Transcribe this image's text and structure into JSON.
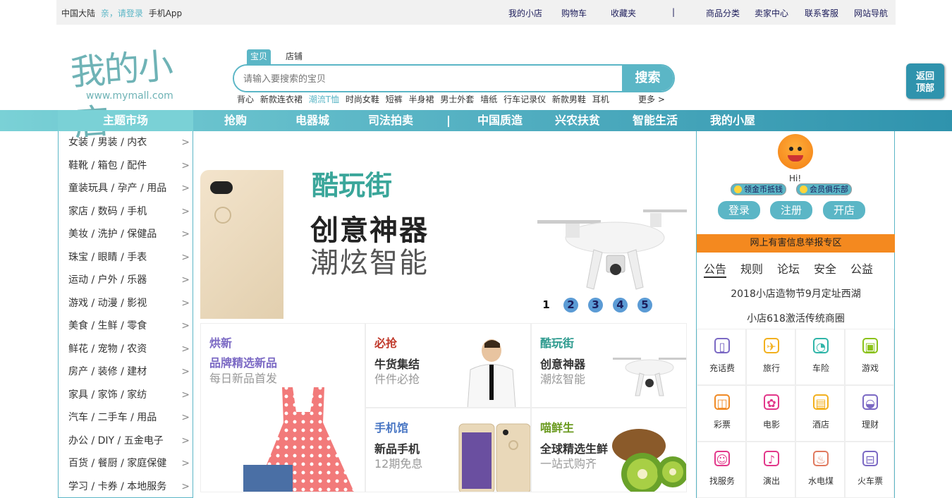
{
  "topbar": {
    "region": "中国大陆",
    "login": "亲，请登录",
    "app": "手机App",
    "links": [
      "我的小店",
      "购物车",
      "收藏夹",
      "|",
      "商品分类",
      "卖家中心",
      "联系客服",
      "网站导航"
    ]
  },
  "logo": {
    "cn": "我的小店",
    "en": "www.mymall.com"
  },
  "search": {
    "tabs": [
      "宝贝",
      "店铺"
    ],
    "placeholder": "请输入要搜索的宝贝",
    "button": "搜索",
    "hot": [
      "背心",
      "新款连衣裙",
      "潮流T恤",
      "时尚女鞋",
      "短裤",
      "半身裙",
      "男士外套",
      "墙纸",
      "行车记录仪",
      "新款男鞋",
      "耳机"
    ],
    "more": "更多 >"
  },
  "back_top": {
    "line1": "返回",
    "line2": "顶部"
  },
  "nav": {
    "category_title": "主题市场",
    "items": [
      "抢购",
      "电器城",
      "司法拍卖",
      "|",
      "中国质造",
      "兴农扶贫",
      "智能生活",
      "我的小屋"
    ]
  },
  "categories": [
    "女装 / 男装 / 内衣",
    "鞋靴 / 箱包 / 配件",
    "童装玩具 / 孕产 / 用品",
    "家店 / 数码 / 手机",
    "美妆 / 洗护 / 保健品",
    "珠宝 / 眼睛 / 手表",
    "运动 / 户外 / 乐器",
    "游戏 / 动漫 / 影视",
    "美食 / 生鲜 / 零食",
    "鲜花 / 宠物 / 农资",
    "房产 / 装修 / 建材",
    "家具 / 家饰 / 家纺",
    "汽车 / 二手车 / 用品",
    "办公 / DIY / 五金电子",
    "百货 / 餐厨 / 家庭保健",
    "学习 / 卡券 / 本地服务"
  ],
  "category_arrow": ">",
  "banner": {
    "title": "酷玩街",
    "line1": "创意神器",
    "line2": "潮炫智能",
    "dots": [
      "1",
      "2",
      "3",
      "4",
      "5"
    ],
    "active_dot": 0
  },
  "promos": [
    {
      "tag": "烘新",
      "title": "品牌精选新品",
      "sub": "每日新品首发",
      "tag_color": "#7b69c4"
    },
    {
      "tag": "必抢",
      "title": "牛货集结",
      "sub": "件件必抢",
      "tag_color": "#c0392b"
    },
    {
      "tag": "酷玩街",
      "title": "创意神器",
      "sub": "潮炫智能",
      "tag_color": "#2c9a8e"
    },
    {
      "tag": "手机馆",
      "title": "新品手机",
      "sub": "12期免息",
      "tag_color": "#4a77c4"
    },
    {
      "tag": "喵鲜生",
      "title": "全球精选生鲜",
      "sub": "一站式购齐",
      "tag_color": "#6a9a1f"
    }
  ],
  "user_panel": {
    "hi": "Hi!",
    "pills": [
      "领金币抵钱",
      "会员俱乐部"
    ],
    "buttons": [
      "登录",
      "注册",
      "开店"
    ],
    "report": "网上有害信息举报专区",
    "tabs": [
      "公告",
      "规则",
      "论坛",
      "安全",
      "公益"
    ],
    "news": [
      "2018小店造物节9月定址西湖",
      "小店618激活传统商圈"
    ]
  },
  "services": [
    {
      "label": "充话费",
      "icon": "phone-icon",
      "color": "#7b69c4"
    },
    {
      "label": "旅行",
      "icon": "travel-icon",
      "color": "#f2b01e"
    },
    {
      "label": "车险",
      "icon": "car-icon",
      "color": "#2fb5a8"
    },
    {
      "label": "游戏",
      "icon": "game-icon",
      "color": "#8bc21a"
    },
    {
      "label": "彩票",
      "icon": "lottery-icon",
      "color": "#f08a24"
    },
    {
      "label": "电影",
      "icon": "movie-icon",
      "color": "#e2378a"
    },
    {
      "label": "酒店",
      "icon": "hotel-icon",
      "color": "#f2b01e"
    },
    {
      "label": "理财",
      "icon": "finance-icon",
      "color": "#7b69c4"
    },
    {
      "label": "找服务",
      "icon": "service-icon",
      "color": "#e2378a"
    },
    {
      "label": "演出",
      "icon": "show-icon",
      "color": "#e2378a"
    },
    {
      "label": "水电煤",
      "icon": "utility-icon",
      "color": "#e07a5f"
    },
    {
      "label": "火车票",
      "icon": "train-icon",
      "color": "#7b69c4"
    }
  ]
}
